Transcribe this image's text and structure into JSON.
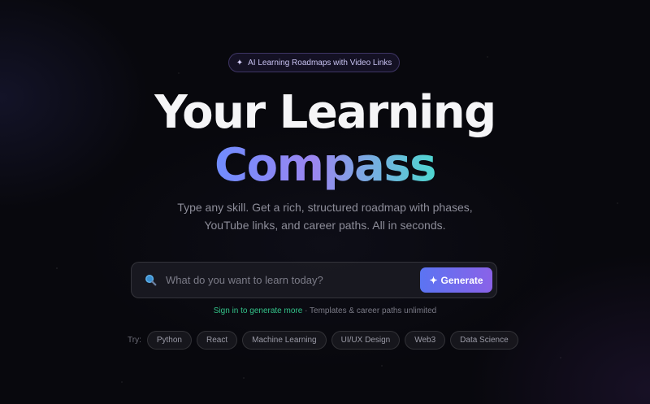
{
  "badge": {
    "icon": "sparkle-icon",
    "label": "AI Learning Roadmaps with Video Links"
  },
  "hero": {
    "title_line1": "Your Learning",
    "title_line2": "Compass",
    "subtitle_line1": "Type any skill. Get a rich, structured roadmap with phases,",
    "subtitle_line2": "YouTube links, and career paths. All in seconds."
  },
  "search": {
    "icon": "search-icon",
    "value": "",
    "placeholder": "What do you want to learn today?",
    "button_label": "Generate",
    "button_icon": "sparkle-icon"
  },
  "note": {
    "link_text": "Sign in to generate more",
    "separator": " · ",
    "rest_text": "Templates & career paths unlimited"
  },
  "suggestions": {
    "label": "Try:",
    "chips": [
      "Python",
      "React",
      "Machine Learning",
      "UI/UX Design",
      "Web3",
      "Data Science"
    ]
  },
  "colors": {
    "background": "#08080d",
    "accent_start": "#5b74f2",
    "accent_end": "#8a62e8",
    "link_green": "#33c48a"
  }
}
